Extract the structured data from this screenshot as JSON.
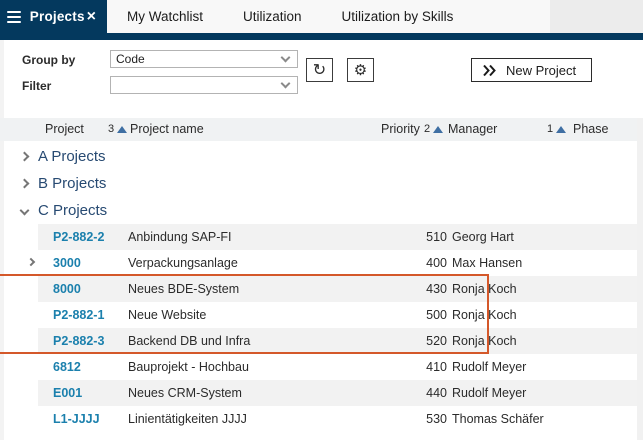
{
  "tabbar": {
    "active_tab": "Projects",
    "tabs": [
      "My Watchlist",
      "Utilization",
      "Utilization by Skills"
    ]
  },
  "icons": {
    "close": "×",
    "refresh": "↻",
    "settings": "⚙"
  },
  "toolbar": {
    "group_by_label": "Group by",
    "group_by_value": "Code",
    "filter_label": "Filter",
    "filter_value": "",
    "new_project_label": "New Project"
  },
  "table": {
    "columns": [
      {
        "label": "Project",
        "sort_order": "3"
      },
      {
        "label": "Project name",
        "sort_order": ""
      },
      {
        "label": "Priority",
        "sort_order": "2"
      },
      {
        "label": "Manager",
        "sort_order": "1"
      },
      {
        "label": "Phase",
        "sort_order": ""
      }
    ],
    "groups": [
      {
        "label": "A Projects",
        "expanded": false
      },
      {
        "label": "B Projects",
        "expanded": false
      },
      {
        "label": "C Projects",
        "expanded": true
      }
    ],
    "rows": [
      {
        "project": "P2-882-2",
        "name": "Anbindung SAP-FI",
        "priority": "510",
        "manager": "Georg Hart",
        "phase": "",
        "expandable": false,
        "highlighted": false
      },
      {
        "project": "3000",
        "name": "Verpackungsanlage",
        "priority": "400",
        "manager": "Max Hansen",
        "phase": "",
        "expandable": true,
        "highlighted": false
      },
      {
        "project": "8000",
        "name": "Neues BDE-System",
        "priority": "430",
        "manager": "Ronja Koch",
        "phase": "",
        "expandable": false,
        "highlighted": true
      },
      {
        "project": "P2-882-1",
        "name": "Neue Website",
        "priority": "500",
        "manager": "Ronja Koch",
        "phase": "",
        "expandable": false,
        "highlighted": true
      },
      {
        "project": "P2-882-3",
        "name": "Backend DB und Infra",
        "priority": "520",
        "manager": "Ronja Koch",
        "phase": "",
        "expandable": false,
        "highlighted": true
      },
      {
        "project": "6812",
        "name": "Bauprojekt - Hochbau",
        "priority": "410",
        "manager": "Rudolf Meyer",
        "phase": "",
        "expandable": false,
        "highlighted": false
      },
      {
        "project": "E001",
        "name": "Neues CRM-System",
        "priority": "440",
        "manager": "Rudolf Meyer",
        "phase": "",
        "expandable": false,
        "highlighted": false
      },
      {
        "project": "L1-JJJJ",
        "name": "Linientätigkeiten JJJJ",
        "priority": "530",
        "manager": "Thomas Schäfer",
        "phase": "",
        "expandable": false,
        "highlighted": false
      }
    ]
  },
  "colors": {
    "navy": "#04395e",
    "link_blue": "#1b80ad",
    "group_text": "#274a72",
    "highlight_border": "#d4582a",
    "row_alt_bg": "#f2f2f2",
    "header_bg": "#f0f2f3",
    "sort_triangle": "#3f6fa3"
  }
}
